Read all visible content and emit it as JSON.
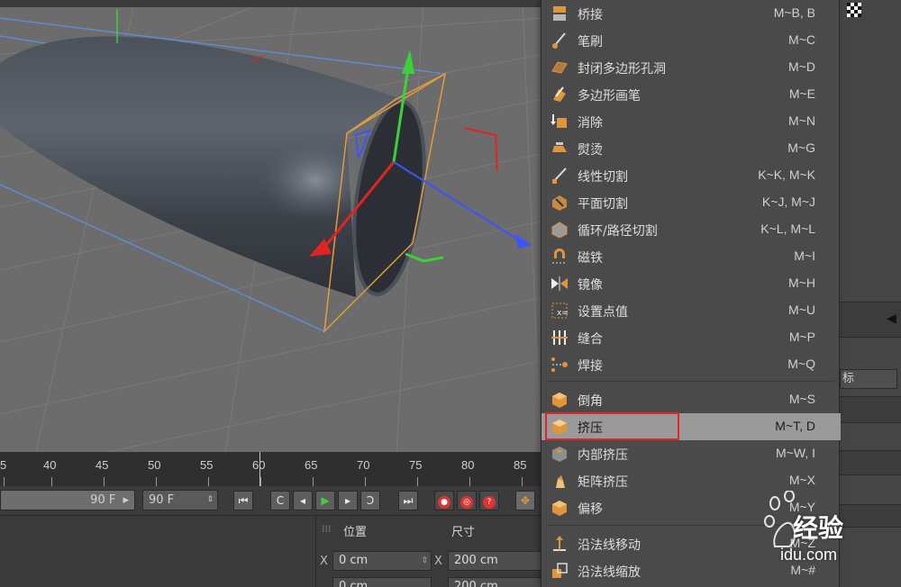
{
  "menu": {
    "items": [
      {
        "label": "桥接",
        "shortcut": "M~B, B",
        "icon": "bridge-icon"
      },
      {
        "label": "笔刷",
        "shortcut": "M~C",
        "icon": "brush-icon"
      },
      {
        "label": "封闭多边形孔洞",
        "shortcut": "M~D",
        "icon": "close-hole-icon"
      },
      {
        "label": "多边形画笔",
        "shortcut": "M~E",
        "icon": "polygon-pen-icon"
      },
      {
        "label": "消除",
        "shortcut": "M~N",
        "icon": "dissolve-icon"
      },
      {
        "label": "熨烫",
        "shortcut": "M~G",
        "icon": "iron-icon"
      },
      {
        "label": "线性切割",
        "shortcut": "K~K, M~K",
        "icon": "line-cut-icon"
      },
      {
        "label": "平面切割",
        "shortcut": "K~J, M~J",
        "icon": "plane-cut-icon"
      },
      {
        "label": "循环/路径切割",
        "shortcut": "K~L, M~L",
        "icon": "loop-cut-icon"
      },
      {
        "label": "磁铁",
        "shortcut": "M~I",
        "icon": "magnet-icon"
      },
      {
        "label": "镜像",
        "shortcut": "M~H",
        "icon": "mirror-icon"
      },
      {
        "label": "设置点值",
        "shortcut": "M~U",
        "icon": "set-point-icon"
      },
      {
        "label": "缝合",
        "shortcut": "M~P",
        "icon": "stitch-icon"
      },
      {
        "label": "焊接",
        "shortcut": "M~Q",
        "icon": "weld-icon"
      },
      {
        "label": "倒角",
        "shortcut": "M~S",
        "icon": "bevel-icon"
      },
      {
        "label": "挤压",
        "shortcut": "M~T, D",
        "icon": "extrude-icon"
      },
      {
        "label": "内部挤压",
        "shortcut": "M~W, I",
        "icon": "extrude-inner-icon"
      },
      {
        "label": "矩阵挤压",
        "shortcut": "M~X",
        "icon": "matrix-extrude-icon"
      },
      {
        "label": "偏移",
        "shortcut": "M~Y",
        "icon": "offset-icon"
      },
      {
        "label": "沿法线移动",
        "shortcut": "M~Z",
        "icon": "normal-move-icon"
      },
      {
        "label": "沿法线缩放",
        "shortcut": "M~#",
        "icon": "normal-scale-icon"
      }
    ],
    "highlighted": "挤压"
  },
  "timeline": {
    "ticks": [
      "5",
      "40",
      "45",
      "50",
      "55",
      "60",
      "65",
      "70",
      "75",
      "80",
      "85"
    ]
  },
  "transport": {
    "end_frame": "90 F",
    "max_frame": "90 F"
  },
  "coords": {
    "position_label": "位置",
    "size_label": "尺寸",
    "axis_x": "X",
    "pos_x": "0 cm",
    "pos_y": "0 cm",
    "size_x": "200 cm",
    "size_y": "200 cm"
  },
  "right_panel": {
    "tab": "标"
  },
  "watermark": {
    "text": "经验",
    "url": "idu.com"
  },
  "colors": {
    "menu_bg": "#4a4a4a",
    "highlight_bg": "#9a9a9a",
    "highlight_box": "#e0252b",
    "viewport_bg": "#6c6c6c"
  }
}
